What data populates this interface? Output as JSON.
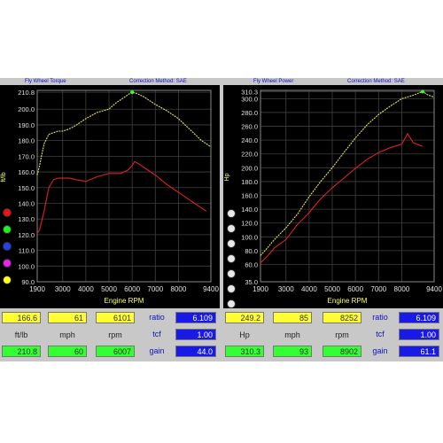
{
  "panels": [
    {
      "id": "torque",
      "header_left": "Fly Wheel Torque",
      "header_right": "Correction Method: SAE",
      "readouts": {
        "row1": [
          "166.6",
          "61",
          "6101"
        ],
        "units": [
          "ft/lb",
          "mph",
          "rpm"
        ],
        "row3": [
          "210.8",
          "60",
          "6007"
        ],
        "side_labels": [
          "ratio",
          "tcf",
          "gain"
        ],
        "side_values": [
          "6.109",
          "1.00",
          "44.0"
        ]
      }
    },
    {
      "id": "power",
      "header_left": "Fly Wheel Power",
      "header_right": "Correction Method: SAE",
      "readouts": {
        "row1": [
          "249.2",
          "85",
          "8252"
        ],
        "units": [
          "Hp",
          "mph",
          "rpm"
        ],
        "row3": [
          "310.3",
          "93",
          "8902"
        ],
        "side_labels": [
          "ratio",
          "tcf",
          "gain"
        ],
        "side_values": [
          "6.109",
          "1.00",
          "61.1"
        ]
      }
    }
  ],
  "colors": {
    "background": "#000000",
    "grid": "#404040",
    "tick_text": "#e0e0e0",
    "axis_label": "#ffff66",
    "series_after": "#e8e850",
    "series_before": "#dd2222",
    "peak_marker": "#33ff33"
  },
  "legend_dots": {
    "left": [
      "#ee1111",
      "#22ee22",
      "#2244ee",
      "#ee22ee",
      "#ffff22"
    ],
    "right": [
      "#e8e8e8",
      "#e8e8e8",
      "#e8e8e8",
      "#e8e8e8",
      "#e8e8e8",
      "#e8e8e8",
      "#e8e8e8"
    ]
  },
  "chart_data": [
    {
      "type": "line",
      "title": "Fly Wheel Torque",
      "xlabel": "Engine RPM",
      "ylabel": "ft/lb",
      "xlim": [
        1900,
        9400
      ],
      "ylim": [
        90,
        212
      ],
      "x_ticks": [
        "1900",
        "3000",
        "4000",
        "5000",
        "6000",
        "7000",
        "8000",
        "9400"
      ],
      "y_ticks": [
        "210.8",
        "200.0",
        "190.0",
        "180.0",
        "170.0",
        "160.0",
        "150.0",
        "140.0",
        "130.0",
        "120.0",
        "110.0",
        "100.0",
        "90.0"
      ],
      "series": [
        {
          "x": [
            1900,
            2000,
            2200,
            2400,
            2600,
            2800,
            3000,
            3200,
            3500,
            4000,
            4500,
            5000,
            5300,
            5600,
            5900,
            6000,
            6200,
            6500,
            6800,
            7000,
            7500,
            8000,
            8500,
            9000,
            9400
          ],
          "y": [
            158,
            164,
            178,
            184,
            185,
            186,
            186,
            187,
            189,
            194,
            198,
            200,
            204,
            207,
            210,
            210.8,
            210,
            208,
            205,
            203,
            199,
            194,
            187,
            180,
            176
          ]
        },
        {
          "x": [
            1900,
            2000,
            2200,
            2400,
            2600,
            2800,
            3000,
            3300,
            3600,
            4000,
            4500,
            5000,
            5500,
            5800,
            6000,
            6100,
            6300,
            6600,
            7000,
            7500,
            8000,
            8500,
            9000,
            9200
          ],
          "y": [
            121,
            123,
            135,
            150,
            155,
            156,
            156,
            156,
            155,
            154,
            157,
            159,
            159,
            161,
            164,
            166.6,
            165,
            162,
            158,
            152,
            147,
            142,
            137,
            135
          ]
        }
      ]
    },
    {
      "type": "line",
      "title": "Fly Wheel Power",
      "xlabel": "Engine RPM",
      "ylabel": "Hp",
      "xlim": [
        1900,
        9400
      ],
      "ylim": [
        35,
        312
      ],
      "x_ticks": [
        "1900",
        "3000",
        "4000",
        "5000",
        "6000",
        "7000",
        "8000",
        "9400"
      ],
      "y_ticks": [
        "310.3",
        "300.0",
        "280.0",
        "260.0",
        "240.0",
        "220.0",
        "200.0",
        "180.0",
        "160.0",
        "140.0",
        "120.0",
        "100.0",
        "80.0",
        "60.0",
        "35.0"
      ],
      "series": [
        {
          "x": [
            1900,
            2200,
            2500,
            3000,
            3500,
            4000,
            4500,
            5000,
            5500,
            6000,
            6500,
            7000,
            7500,
            8000,
            8500,
            8902,
            9100,
            9400
          ],
          "y": [
            73,
            84,
            96,
            113,
            133,
            158,
            180,
            200,
            222,
            243,
            262,
            277,
            289,
            300,
            305,
            310.3,
            306,
            302
          ]
        },
        {
          "x": [
            1900,
            2200,
            2500,
            3000,
            3500,
            4000,
            4500,
            5000,
            5500,
            6000,
            6500,
            7000,
            7500,
            8000,
            8252,
            8500,
            8900
          ],
          "y": [
            62,
            72,
            84,
            96,
            118,
            135,
            155,
            171,
            185,
            199,
            212,
            222,
            229,
            234,
            249.2,
            236,
            231
          ]
        }
      ]
    }
  ]
}
